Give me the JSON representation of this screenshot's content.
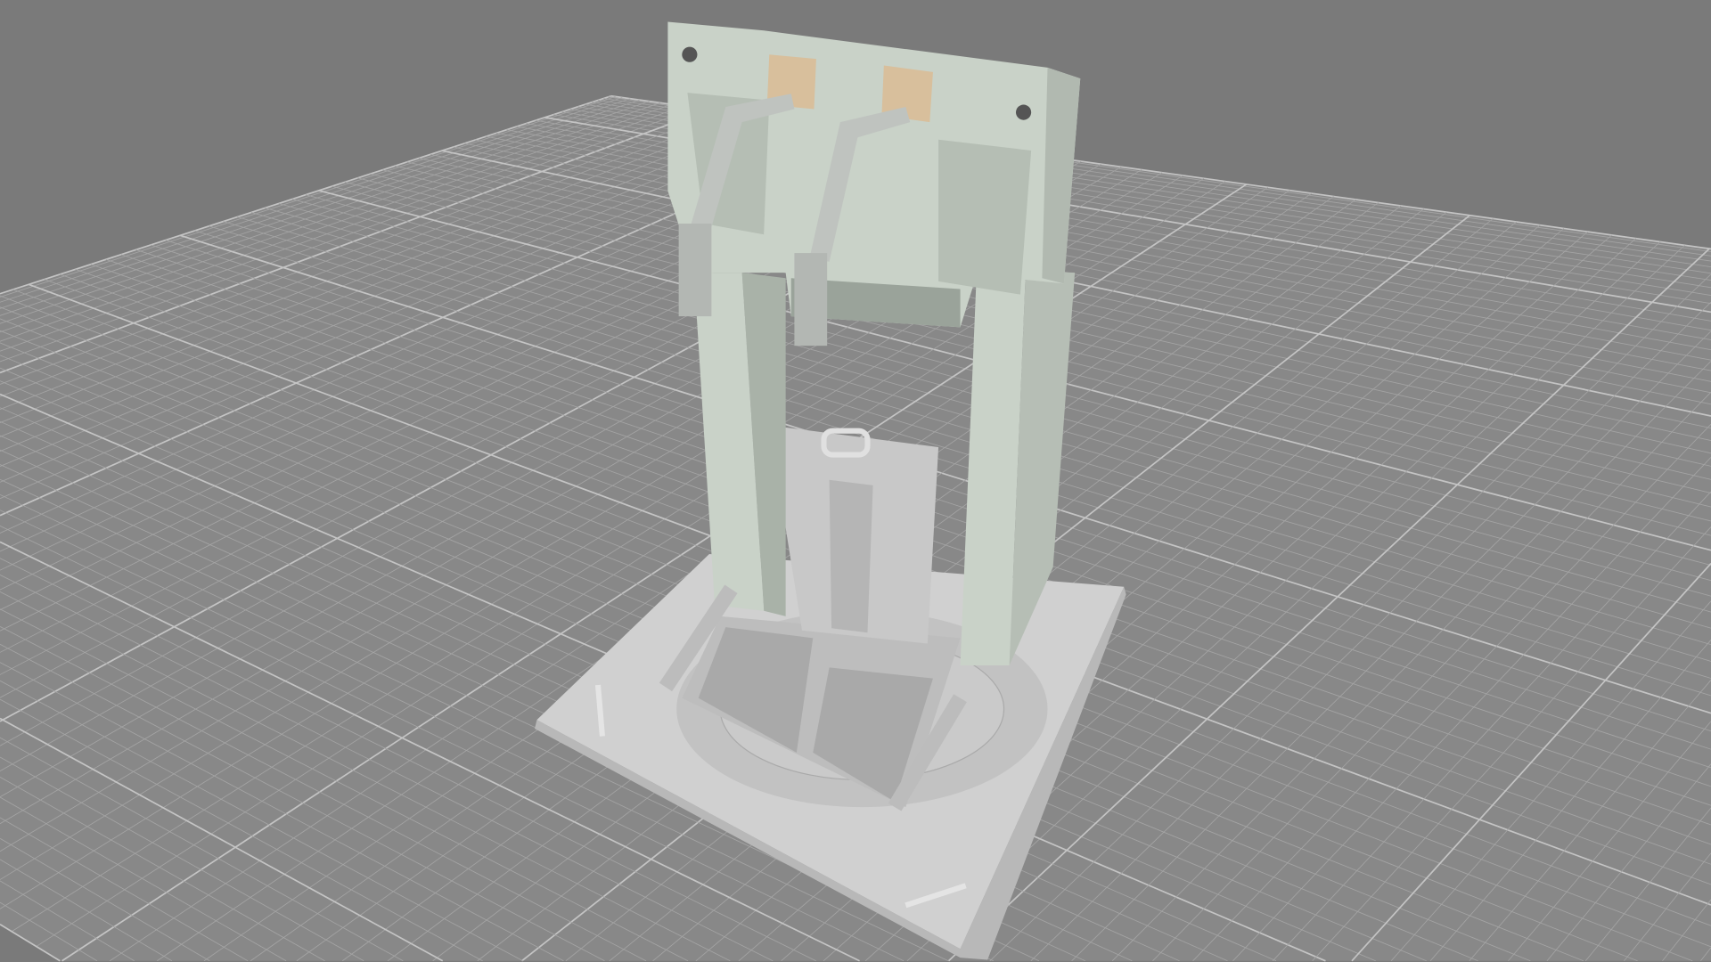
{
  "viewport": {
    "background": "#7a7a7a",
    "grid_fill": "#888888",
    "grid_line": "#a4a4a4",
    "grid_major_line": "#c4c4c4",
    "grid_divisions": 90,
    "grid_major_every": 10
  },
  "model": {
    "frame_color": "#c9d2c8",
    "frame_shadow": "#a9b2a8",
    "accent_color": "#d8bf9c",
    "base_color": "#d2d2d2",
    "base_shadow": "#a8a8a8",
    "arm_color": "#bfc3bf"
  }
}
